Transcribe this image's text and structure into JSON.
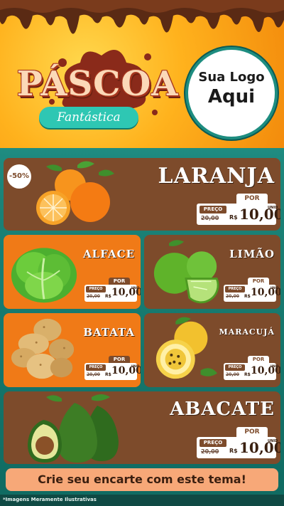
{
  "header": {
    "title": "PÁSCOA",
    "subtitle": "Fantástica",
    "logo_line1": "Sua Logo",
    "logo_line2": "Aqui"
  },
  "badge": "-50%",
  "price_labels": {
    "por": "POR",
    "preco": "PREÇO",
    "currency": "R$",
    "unit": "UNID"
  },
  "products": [
    {
      "name": "LARANJA",
      "old_price": "20,00",
      "price": "10,00"
    },
    {
      "name": "ALFACE",
      "old_price": "20,00",
      "price": "10,00"
    },
    {
      "name": "LIMÃO",
      "old_price": "20,00",
      "price": "10,00"
    },
    {
      "name": "BATATA",
      "old_price": "20,00",
      "price": "10,00"
    },
    {
      "name": "MARACUJÁ",
      "old_price": "20,00",
      "price": "10,00"
    },
    {
      "name": "ABACATE",
      "old_price": "20,00",
      "price": "10,00"
    }
  ],
  "cta": "Crie seu encarte com este tema!",
  "disclaimer": "*Imagens Meramente Ilustrativas",
  "colors": {
    "brown": "#7d4b2b",
    "orange": "#f07a17",
    "teal": "#1b8277",
    "yellow": "#ffb21d"
  }
}
